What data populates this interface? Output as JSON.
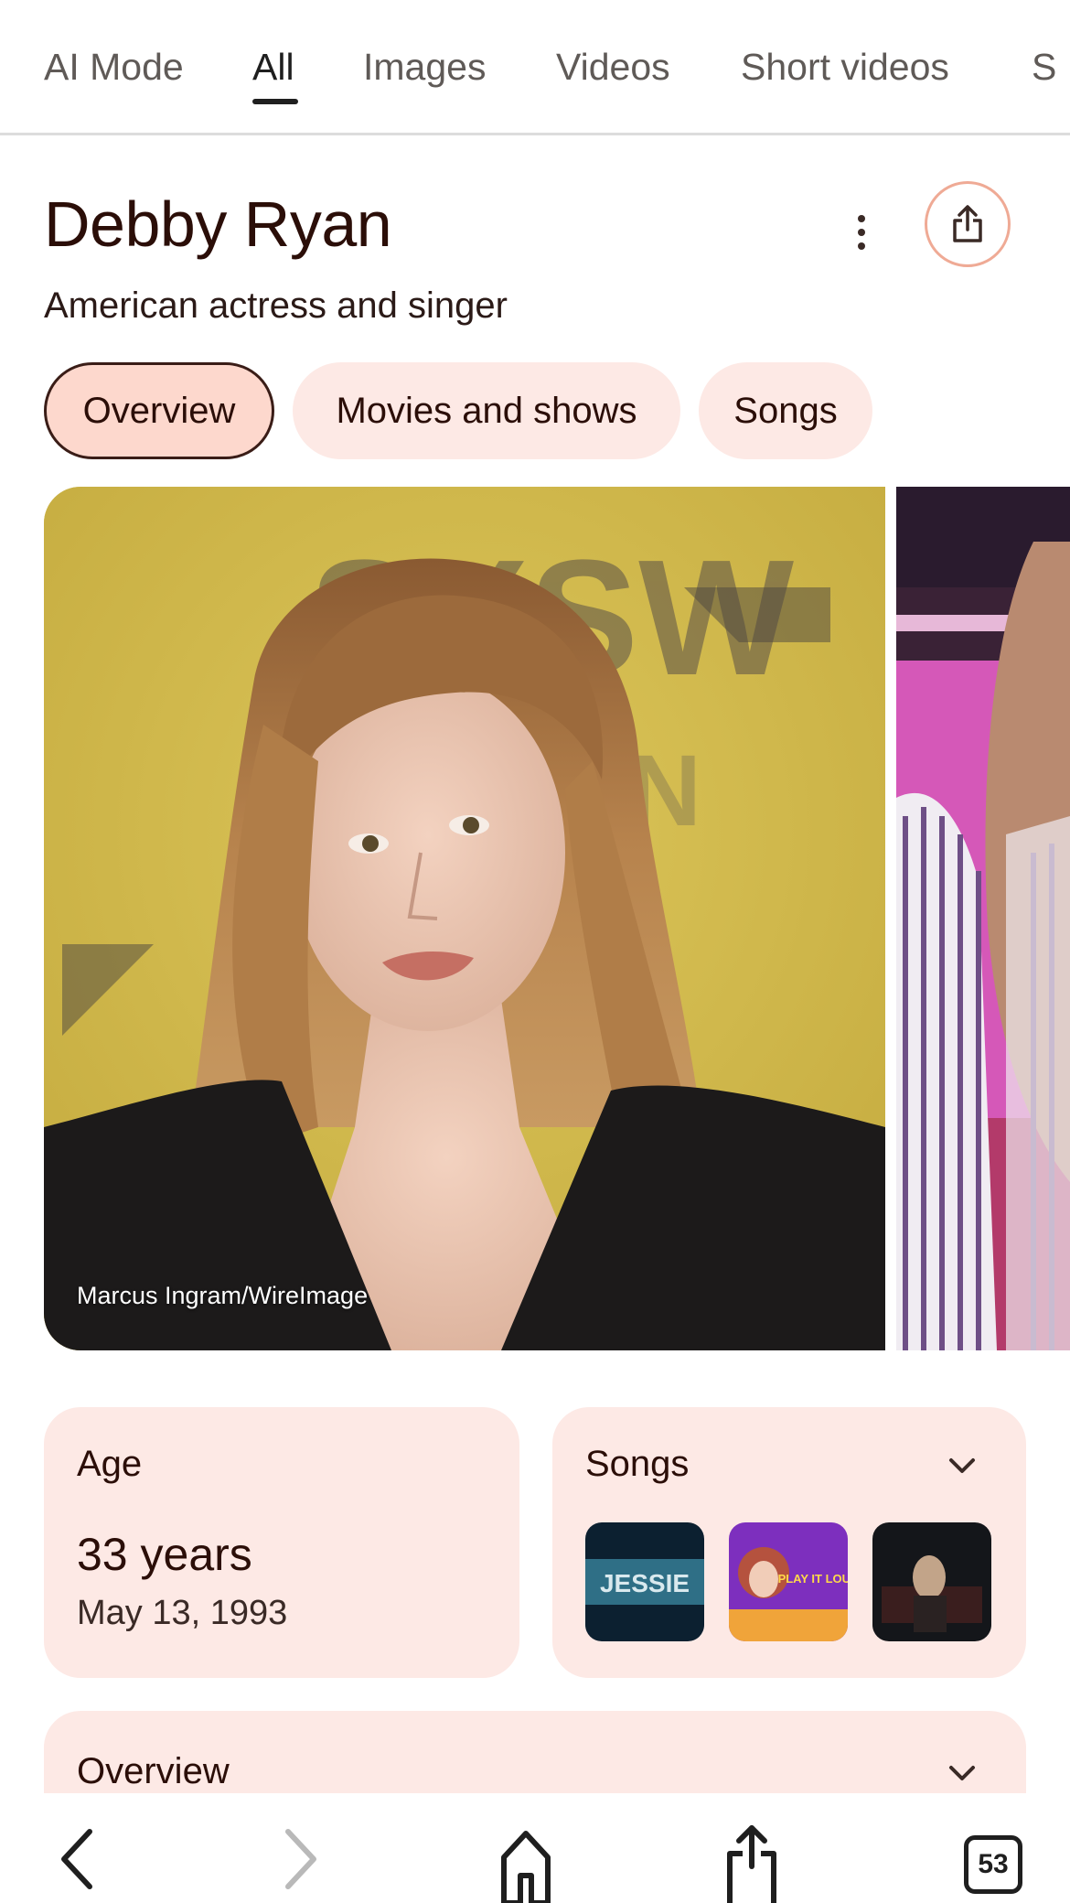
{
  "tabs": [
    {
      "label": "AI Mode"
    },
    {
      "label": "All",
      "active": true
    },
    {
      "label": "Images"
    },
    {
      "label": "Videos"
    },
    {
      "label": "Short videos"
    },
    {
      "label": "S"
    }
  ],
  "header": {
    "title": "Debby Ryan",
    "subtitle": "American actress and singer"
  },
  "chips": [
    {
      "label": "Overview",
      "active": true
    },
    {
      "label": "Movies and shows"
    },
    {
      "label": "Songs"
    }
  ],
  "photo": {
    "credit": "Marcus Ingram/WireImage",
    "backdrop_text": "SXSW"
  },
  "age_card": {
    "label": "Age",
    "value": "33 years",
    "birth_date": "May 13, 1993"
  },
  "songs_card": {
    "label": "Songs",
    "thumbnails": [
      {
        "icon": "jessie-album-thumbnail",
        "text": "JESSIE"
      },
      {
        "icon": "play-it-loud-thumbnail",
        "text": "PLAY IT LOUD"
      },
      {
        "icon": "music-video-thumbnail"
      }
    ]
  },
  "overview_card": {
    "label": "Overview"
  },
  "bottom_nav": {
    "tab_count": "53"
  },
  "colors": {
    "accent_chip": "#fdd8cd",
    "card_bg": "#fde9e5",
    "share_ring": "#efaa95",
    "title": "#2b0e08"
  }
}
